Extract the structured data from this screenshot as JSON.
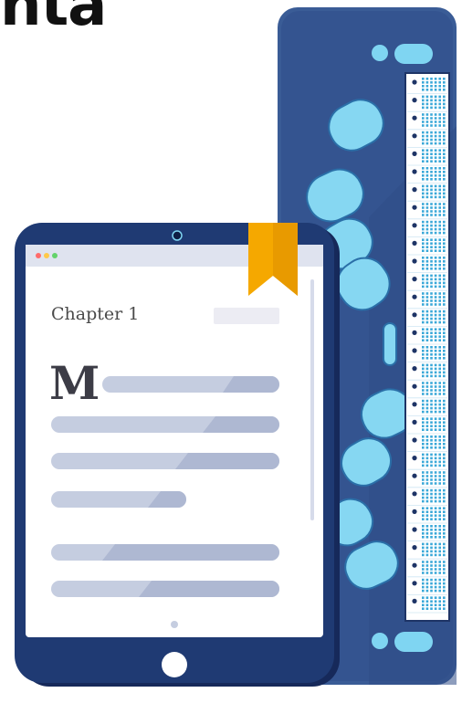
{
  "header": {
    "heading_text": "nta"
  },
  "tablet": {
    "chapter_title": "Chapter 1",
    "drop_cap": "M",
    "window_dots": [
      "red-dot",
      "yellow-dot",
      "green-dot"
    ]
  },
  "colors": {
    "display_blue": "#3a5c96",
    "tablet_navy": "#1f3a73",
    "accent_cyan": "#7fd5f2",
    "bookmark_orange": "#f5a800",
    "text_line": "#c5cde0",
    "screen_bg": "#ffffff"
  },
  "icons": [
    "bookmark-icon",
    "camera-icon",
    "home-button-icon"
  ]
}
